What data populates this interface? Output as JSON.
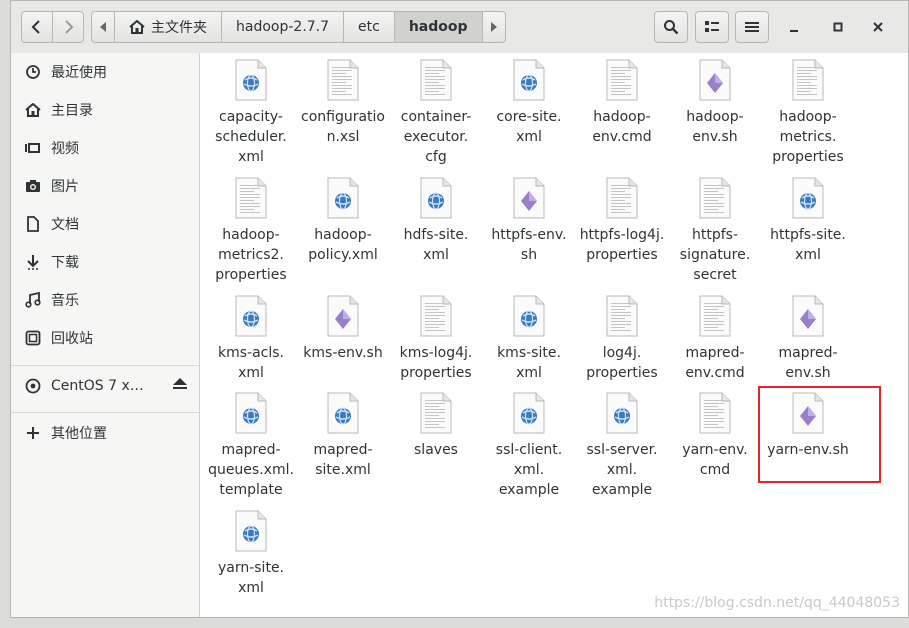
{
  "window": {
    "nav": {
      "back_icon": "chevron-left-icon",
      "forward_icon": "chevron-right-icon"
    },
    "breadcrumbs": [
      "主文件夹",
      "hadoop-2.7.7",
      "etc",
      "hadoop"
    ],
    "toolbar": {
      "search_icon": "search-icon",
      "view_icon": "list-view-icon",
      "menu_icon": "hamburger-menu-icon"
    },
    "controls": {
      "minimize": "minimize-icon",
      "maximize": "maximize-icon",
      "close": "close-icon"
    }
  },
  "sidebar": {
    "items": [
      {
        "label": "最近使用",
        "icon": "clock-icon"
      },
      {
        "label": "主目录",
        "icon": "home-icon"
      },
      {
        "label": "视频",
        "icon": "video-icon"
      },
      {
        "label": "图片",
        "icon": "camera-icon"
      },
      {
        "label": "文档",
        "icon": "document-icon"
      },
      {
        "label": "下载",
        "icon": "download-icon"
      },
      {
        "label": "音乐",
        "icon": "music-icon"
      },
      {
        "label": "回收站",
        "icon": "trash-icon"
      }
    ],
    "device": {
      "label": "CentOS 7 x…",
      "icon": "disc-icon",
      "eject_icon": "eject-icon"
    },
    "other": {
      "label": "其他位置",
      "icon": "plus-icon"
    }
  },
  "files": [
    {
      "name": "capacity-scheduler.xml",
      "lines": [
        "capacity-",
        "scheduler.",
        "xml"
      ],
      "type": "web"
    },
    {
      "name": "configuration.xsl",
      "lines": [
        "configuratio",
        "n.xsl"
      ],
      "type": "text"
    },
    {
      "name": "container-executor.cfg",
      "lines": [
        "container-",
        "executor.",
        "cfg"
      ],
      "type": "text"
    },
    {
      "name": "core-site.xml",
      "lines": [
        "core-site.",
        "xml"
      ],
      "type": "web"
    },
    {
      "name": "hadoop-env.cmd",
      "lines": [
        "hadoop-",
        "env.cmd"
      ],
      "type": "text"
    },
    {
      "name": "hadoop-env.sh",
      "lines": [
        "hadoop-",
        "env.sh"
      ],
      "type": "script"
    },
    {
      "name": "hadoop-metrics.properties",
      "lines": [
        "hadoop-",
        "metrics.",
        "properties"
      ],
      "type": "text"
    },
    {
      "name": "hadoop-metrics2.properties",
      "lines": [
        "hadoop-",
        "metrics2.",
        "properties"
      ],
      "type": "text"
    },
    {
      "name": "hadoop-policy.xml",
      "lines": [
        "hadoop-",
        "policy.xml"
      ],
      "type": "web"
    },
    {
      "name": "hdfs-site.xml",
      "lines": [
        "hdfs-site.",
        "xml"
      ],
      "type": "web"
    },
    {
      "name": "httpfs-env.sh",
      "lines": [
        "httpfs-env.",
        "sh"
      ],
      "type": "script"
    },
    {
      "name": "httpfs-log4j.properties",
      "lines": [
        "httpfs-log4j.",
        "properties"
      ],
      "type": "text"
    },
    {
      "name": "httpfs-signature.secret",
      "lines": [
        "httpfs-",
        "signature.",
        "secret"
      ],
      "type": "text"
    },
    {
      "name": "httpfs-site.xml",
      "lines": [
        "httpfs-site.",
        "xml"
      ],
      "type": "web"
    },
    {
      "name": "kms-acls.xml",
      "lines": [
        "kms-acls.",
        "xml"
      ],
      "type": "web"
    },
    {
      "name": "kms-env.sh",
      "lines": [
        "kms-env.sh"
      ],
      "type": "script"
    },
    {
      "name": "kms-log4j.properties",
      "lines": [
        "kms-log4j.",
        "properties"
      ],
      "type": "text"
    },
    {
      "name": "kms-site.xml",
      "lines": [
        "kms-site.",
        "xml"
      ],
      "type": "web"
    },
    {
      "name": "log4j.properties",
      "lines": [
        "log4j.",
        "properties"
      ],
      "type": "text"
    },
    {
      "name": "mapred-env.cmd",
      "lines": [
        "mapred-",
        "env.cmd"
      ],
      "type": "text"
    },
    {
      "name": "mapred-env.sh",
      "lines": [
        "mapred-",
        "env.sh"
      ],
      "type": "script"
    },
    {
      "name": "mapred-queues.xml.template",
      "lines": [
        "mapred-",
        "queues.xml.",
        "template"
      ],
      "type": "web"
    },
    {
      "name": "mapred-site.xml",
      "lines": [
        "mapred-",
        "site.xml"
      ],
      "type": "web"
    },
    {
      "name": "slaves",
      "lines": [
        "slaves"
      ],
      "type": "text"
    },
    {
      "name": "ssl-client.xml.example",
      "lines": [
        "ssl-client.",
        "xml.",
        "example"
      ],
      "type": "web"
    },
    {
      "name": "ssl-server.xml.example",
      "lines": [
        "ssl-server.",
        "xml.",
        "example"
      ],
      "type": "web"
    },
    {
      "name": "yarn-env.cmd",
      "lines": [
        "yarn-env.",
        "cmd"
      ],
      "type": "text"
    },
    {
      "name": "yarn-env.sh",
      "lines": [
        "yarn-env.sh"
      ],
      "type": "script"
    },
    {
      "name": "yarn-site.xml",
      "lines": [
        "yarn-site.",
        "xml"
      ],
      "type": "web"
    }
  ],
  "highlighted_file": "yarn-env.sh",
  "colors": {
    "highlight": "#e3242b",
    "script_icon": "#9b7fc9",
    "web_icon": "#3a7ac0"
  },
  "watermark": "https://blog.csdn.net/qq_44048053"
}
